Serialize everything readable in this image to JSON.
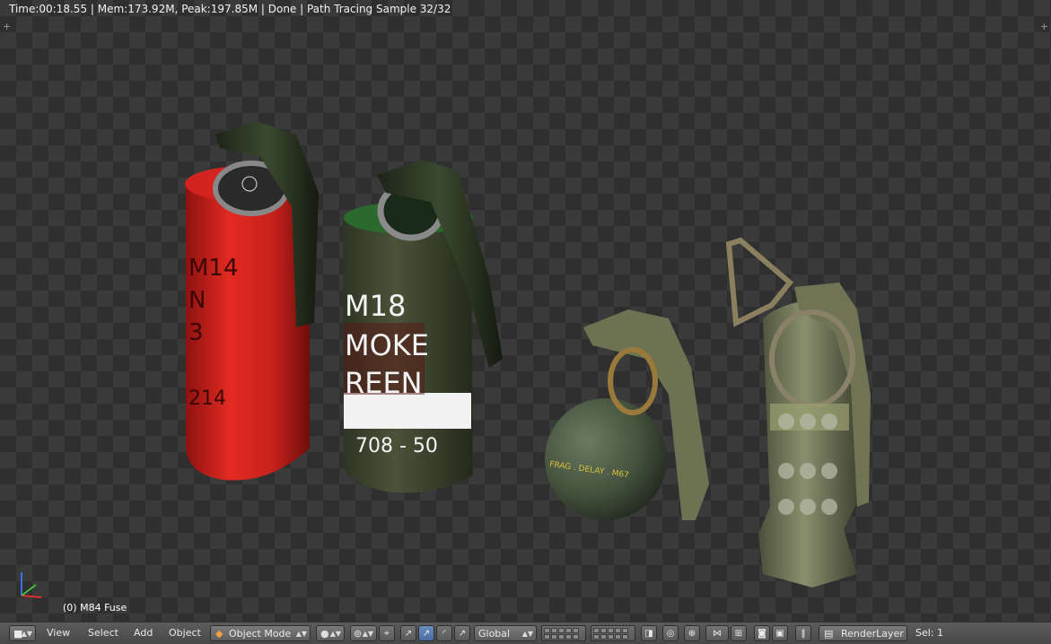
{
  "render_status": "Time:00:18.55 | Mem:173.92M, Peak:197.85M | Done | Path Tracing Sample 32/32",
  "active_object_label": "(0) M84 Fuse",
  "grenades": {
    "red": {
      "lines": [
        "M14",
        "N",
        "3",
        "214"
      ],
      "color": "#cc1d17"
    },
    "green_smoke": {
      "lines": [
        "M18",
        "MOKE",
        "REEN",
        "708 - 50"
      ],
      "color": "#3f4530"
    },
    "frag": {
      "text": "FRAG . DELAY . M67",
      "color": "#4b5a48"
    },
    "flashbang": {
      "color": "#6e7458"
    }
  },
  "header": {
    "menu": {
      "view": "View",
      "select": "Select",
      "add": "Add",
      "object": "Object"
    },
    "mode": "Object Mode",
    "orientation": "Global",
    "render_layer": "RenderLayer",
    "selection": "Sel: 1",
    "icons": [
      "editor-type-icon",
      "viewport-shading-icon",
      "pivot-point-icon",
      "manipulator-icon",
      "translate-icon",
      "rotate-icon",
      "scale-icon",
      "lock-camera-icon",
      "proportional-edit-icon",
      "snap-icon",
      "snap-target-icon",
      "render-preview-icon",
      "opengl-render-icon",
      "opengl-animation-icon",
      "render-layer-icon"
    ]
  },
  "colors": {
    "viewport_dark": "#2f2f2f",
    "viewport_light": "#3a3a3a",
    "header_bg": "#565656",
    "status_text": "#f2f2f2"
  }
}
